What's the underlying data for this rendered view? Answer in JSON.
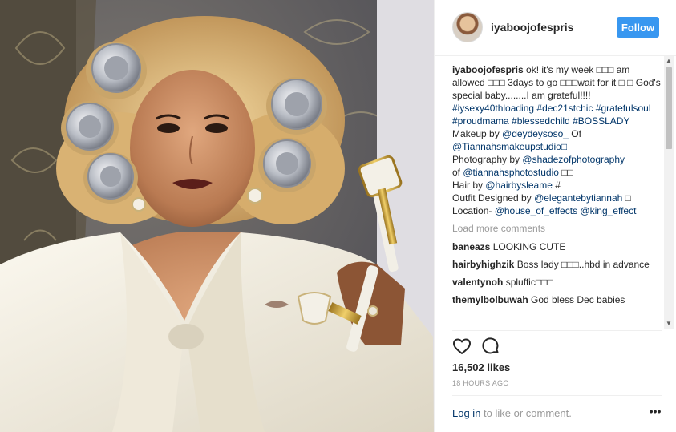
{
  "post": {
    "username": "iyaboojofespris",
    "follow_label": "Follow",
    "caption_text": "ok! it's my week □□□ am allowed □□□ 3days to go □□□wait for it □ □ God's special baby........I am grateful!!!!",
    "hashtags_1": "#iysexy40thloading #dec21stchic #gratefulsoul",
    "hashtags_2": "#proudmama #blessedchild #BOSSLADY",
    "makeup_prefix": "Makeup by ",
    "makeup_tag": "@deydeysoso_",
    "makeup_of": " Of",
    "makeup_studio": "@Tiannahsmakeupstudio□",
    "photo_prefix": "Photography by ",
    "photo_tag": "@shadezofphotography",
    "photo_of": "of ",
    "photo_studio": "@tiannahsphotostudio",
    "photo_suffix": " □□",
    "hair_prefix": "Hair by ",
    "hair_tag": "@hairbysleame",
    "hair_suffix": " #",
    "outfit_prefix": "Outfit Designed by ",
    "outfit_tag": "@elegantebytiannah",
    "outfit_suffix": " □",
    "location_prefix": "Location- ",
    "location_tag_1": "@house_of_effects",
    "location_tag_2": "@king_effect",
    "load_more": "Load more comments",
    "comments": [
      {
        "user": "baneazs",
        "text": "LOOKING CUTE"
      },
      {
        "user": "hairbyhighzik",
        "text": "Boss lady □□□..hbd in advance"
      },
      {
        "user": "valentynoh",
        "text": "spluffic□□□"
      },
      {
        "user": "themylbolbuwah",
        "text": "God bless Dec babies"
      }
    ],
    "likes": "16,502 likes",
    "timestamp": "18 HOURS AGO",
    "login_link": "Log in",
    "login_rest": " to like or comment.",
    "more_label": "•••"
  },
  "icons": {
    "heart": "heart-icon",
    "comment": "comment-icon",
    "scroll_up": "▲",
    "scroll_down": "▼"
  },
  "colors": {
    "follow_blue": "#3897f0",
    "link_blue": "#003569",
    "muted_gray": "#999999"
  }
}
